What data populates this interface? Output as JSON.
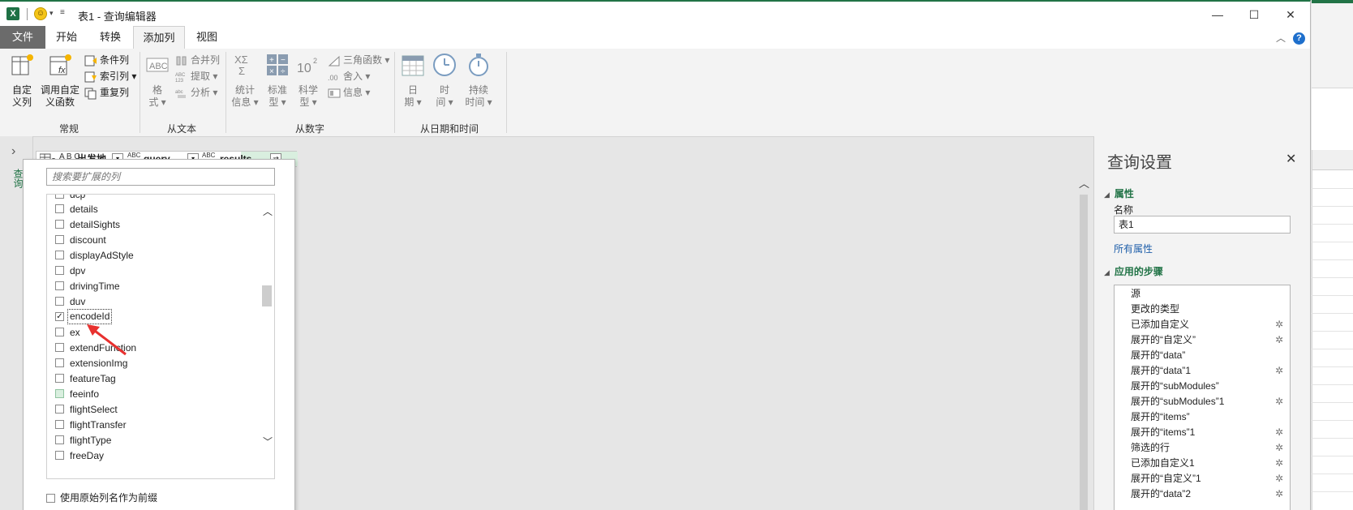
{
  "window": {
    "title": "表1 - 查询编辑器",
    "minimize": "—",
    "maximize": "☐",
    "close": "✕",
    "help": "?"
  },
  "tabs": [
    {
      "label": "文件"
    },
    {
      "label": "开始"
    },
    {
      "label": "转换"
    },
    {
      "label": "添加列",
      "active": true
    },
    {
      "label": "视图"
    }
  ],
  "ribbon": {
    "group_general": {
      "label": "常规",
      "custom_column": [
        "自定",
        "义列"
      ],
      "invoke_function": [
        "调用自定",
        "义函数"
      ],
      "conditional_column": "条件列",
      "index_column": "索引列",
      "duplicate_column": "重复列"
    },
    "group_text": {
      "label": "从文本",
      "format": [
        "格",
        "式"
      ],
      "merge_columns": "合并列",
      "extract": "提取",
      "parse": "分析"
    },
    "group_number": {
      "label": "从数字",
      "statistics": [
        "统计",
        "信息"
      ],
      "standard": [
        "标准",
        "型"
      ],
      "scientific": [
        "科学",
        "型"
      ],
      "trig": "三角函数",
      "rounding": "舍入",
      "information": "信息"
    },
    "group_datetime": {
      "label": "从日期和时间",
      "date": [
        "日",
        "期"
      ],
      "time": [
        "时",
        "间"
      ],
      "duration": [
        "持续",
        "时间"
      ]
    }
  },
  "left_pane": {
    "label": "查询"
  },
  "columns": {
    "col1": "出发地",
    "col2": "query",
    "col3": "results",
    "type_abc": "ABC",
    "type_123": "123",
    "type_ac": "A B C"
  },
  "expand_popup": {
    "search_placeholder": "搜索要扩展的列",
    "items": [
      {
        "label": "dcp",
        "checked": false
      },
      {
        "label": "details",
        "checked": false
      },
      {
        "label": "detailSights",
        "checked": false
      },
      {
        "label": "discount",
        "checked": false
      },
      {
        "label": "displayAdStyle",
        "checked": false
      },
      {
        "label": "dpv",
        "checked": false
      },
      {
        "label": "drivingTime",
        "checked": false
      },
      {
        "label": "duv",
        "checked": false
      },
      {
        "label": "encodeId",
        "checked": true
      },
      {
        "label": "ex",
        "checked": false
      },
      {
        "label": "extendFunction",
        "checked": false
      },
      {
        "label": "extensionImg",
        "checked": false
      },
      {
        "label": "featureTag",
        "checked": false
      },
      {
        "label": "feeinfo",
        "checked": false,
        "highlight": true
      },
      {
        "label": "flightSelect",
        "checked": false
      },
      {
        "label": "flightTransfer",
        "checked": false
      },
      {
        "label": "flightType",
        "checked": false
      },
      {
        "label": "freeDay",
        "checked": false
      }
    ],
    "prefix_option": "使用原始列名作为前缀"
  },
  "query_settings": {
    "title": "查询设置",
    "properties_heading": "属性",
    "name_label": "名称",
    "name_value": "表1",
    "all_properties": "所有属性",
    "steps_heading": "应用的步骤",
    "steps": [
      {
        "label": "源",
        "gear": false
      },
      {
        "label": "更改的类型",
        "gear": false
      },
      {
        "label": "已添加自定义",
        "gear": true
      },
      {
        "label": "展开的“自定义”",
        "gear": true
      },
      {
        "label": "展开的“data”",
        "gear": false
      },
      {
        "label": "展开的“data”1",
        "gear": true
      },
      {
        "label": "展开的“subModules”",
        "gear": false
      },
      {
        "label": "展开的“subModules”1",
        "gear": true
      },
      {
        "label": "展开的“items”",
        "gear": false
      },
      {
        "label": "展开的“items”1",
        "gear": true
      },
      {
        "label": "筛选的行",
        "gear": true
      },
      {
        "label": "已添加自定义1",
        "gear": true
      },
      {
        "label": "展开的“自定义”1",
        "gear": true
      },
      {
        "label": "展开的“data”2",
        "gear": true
      }
    ]
  },
  "colors": {
    "excel_green": "#217346",
    "accent_red": "#e8312f",
    "link_blue": "#1f5faa"
  }
}
